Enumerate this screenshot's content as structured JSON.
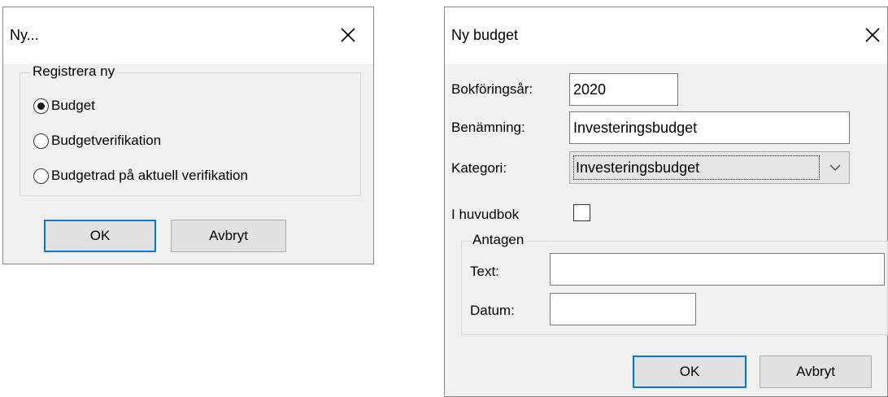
{
  "dialog_ny": {
    "title": "Ny...",
    "group_label": "Registrera ny",
    "options": [
      {
        "label": "Budget",
        "checked": true
      },
      {
        "label": "Budgetverifikation",
        "checked": false
      },
      {
        "label": "Budgetrad på aktuell verifikation",
        "checked": false
      }
    ],
    "ok_label": "OK",
    "cancel_label": "Avbryt"
  },
  "dialog_budget": {
    "title": "Ny budget",
    "fiscal_year_label": "Bokföringsår:",
    "fiscal_year_value": "2020",
    "name_label": "Benämning:",
    "name_value": "Investeringsbudget",
    "category_label": "Kategori:",
    "category_value": "Investeringsbudget",
    "ledger_label": "I huvudbok",
    "ledger_checked": false,
    "group_label": "Antagen",
    "text_label": "Text:",
    "text_value": "",
    "date_label": "Datum:",
    "date_value": "",
    "ok_label": "OK",
    "cancel_label": "Avbryt"
  }
}
